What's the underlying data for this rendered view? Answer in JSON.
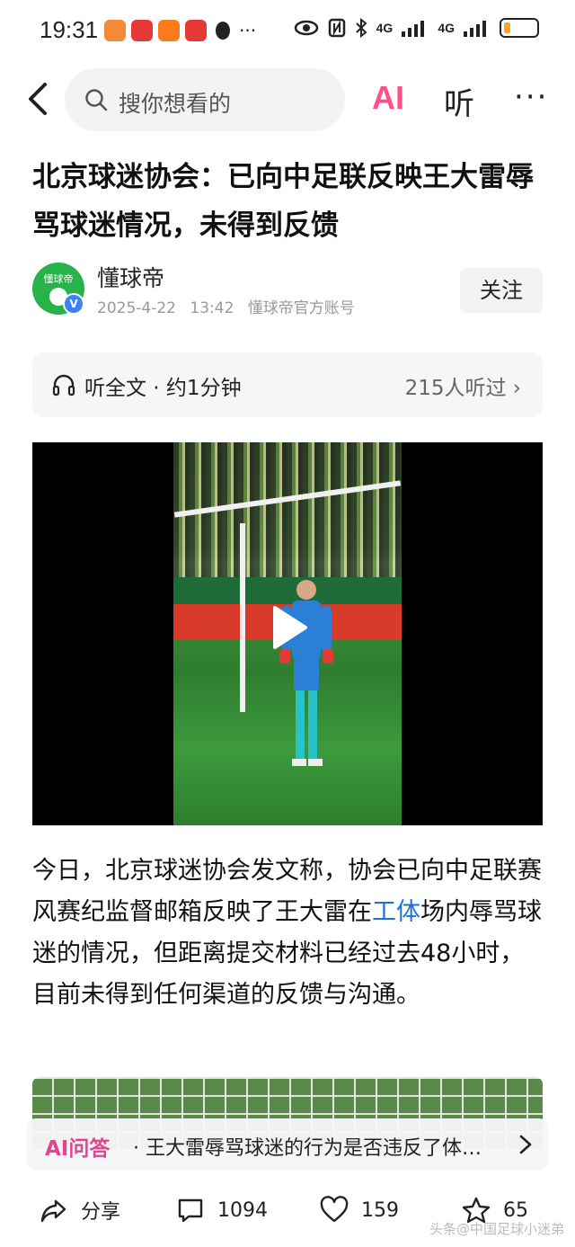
{
  "status_bar": {
    "time": "19:31",
    "more": "···",
    "signal1": "4G",
    "signal2": "4G",
    "battery_level": 0.2,
    "notif_colors": [
      "#f28a3a",
      "#e53935",
      "#ff7a1a",
      "#e53935"
    ]
  },
  "topbar": {
    "search_placeholder": "搜你想看的",
    "ai_label": "AI",
    "listen_label": "听",
    "more_label": "···"
  },
  "article": {
    "title": "北京球迷协会：已向中足联反映王大雷辱骂球迷情况，未得到反馈",
    "author": {
      "name": "懂球帝",
      "avatar_text": "懂球帝",
      "date": "2025-4-22",
      "time": "13:42",
      "account_type": "懂球帝官方账号"
    },
    "follow_label": "关注",
    "listen": {
      "label": "听全文 · 约1分钟",
      "count": "215人听过 ›"
    },
    "body_before_link": "今日，北京球迷协会发文称，协会已向中足联赛风赛纪监督邮箱反映了王大雷在",
    "body_link": "工体",
    "body_after_link": "场内辱骂球迷的情况，但距离提交材料已经过去48小时，目前未得到任何渠道的反馈与沟通。"
  },
  "ai_qa": {
    "label": "AI问答",
    "question": "· 王大雷辱骂球迷的行为是否违反了体…"
  },
  "bottom_bar": {
    "share_label": "分享",
    "comment_count": "1094",
    "like_count": "159",
    "favorite_count": "65",
    "watermark": "头条@中国足球小迷弟"
  },
  "colors": {
    "accent_link": "#1f6fd6",
    "ai_pink": "#e0468f",
    "avatar_green": "#27b24a"
  }
}
